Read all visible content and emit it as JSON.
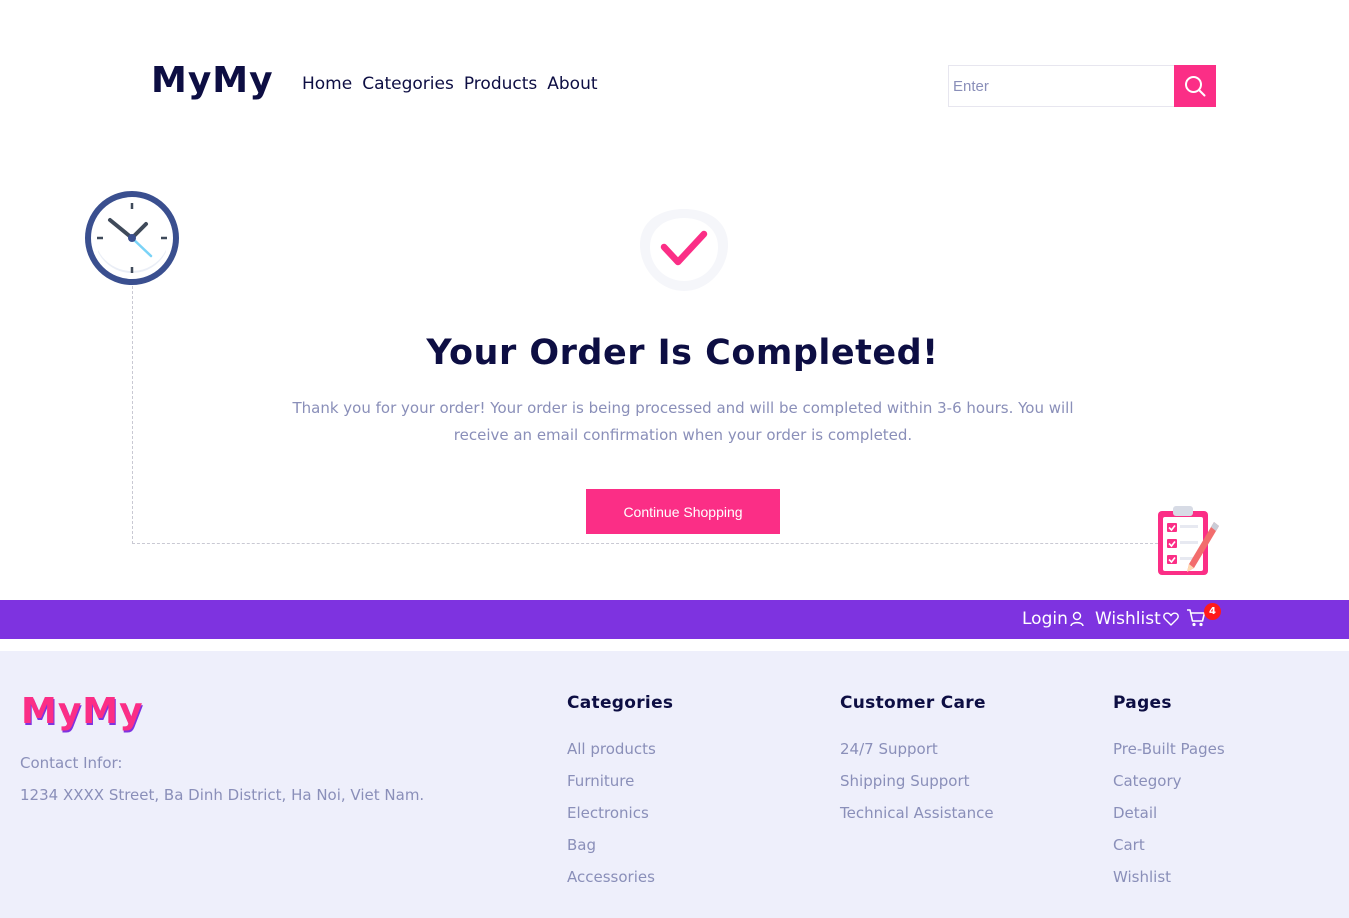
{
  "header": {
    "logo": "MyMy",
    "nav": [
      "Home",
      "Categories",
      "Products",
      "About"
    ],
    "search_placeholder": "Enter"
  },
  "main": {
    "title": "Your Order Is Completed!",
    "message": "Thank you for your order! Your order is being processed and will be completed within 3-6 hours. You will receive an email confirmation when your order is completed.",
    "continue_label": "Continue Shopping"
  },
  "topbar": {
    "login_label": "Login",
    "wishlist_label": "Wishlist",
    "cart_count": "4"
  },
  "footer": {
    "logo": "MyMy",
    "contact_label": "Contact Infor:",
    "address": "1234 XXXX Street, Ba Dinh District, Ha Noi, Viet Nam.",
    "columns": [
      {
        "title": "Categories",
        "links": [
          "All products",
          "Furniture",
          "Electronics",
          "Bag",
          "Accessories"
        ]
      },
      {
        "title": "Customer Care",
        "links": [
          "24/7 Support",
          "Shipping Support",
          "Technical Assistance"
        ]
      },
      {
        "title": "Pages",
        "links": [
          "Pre-Built Pages",
          "Category",
          "Detail",
          "Cart",
          "Wishlist"
        ]
      }
    ]
  },
  "colors": {
    "accent": "#fb2e86",
    "purple": "#7e33e0",
    "navy": "#0d0e43",
    "muted": "#8a8fb9",
    "footer_bg": "#eeeffb"
  },
  "icons": [
    "search-icon",
    "clock-icon",
    "checkmark-icon",
    "clipboard-checklist-icon",
    "user-icon",
    "heart-icon",
    "cart-icon"
  ]
}
